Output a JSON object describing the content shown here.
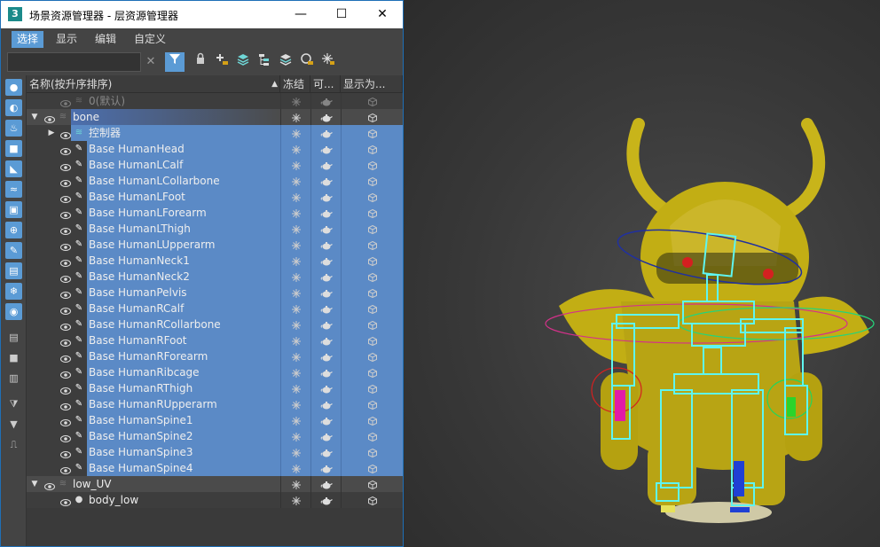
{
  "window": {
    "title": "场景资源管理器 - 层资源管理器",
    "app_icon_label": "3",
    "minimize_glyph": "—",
    "maximize_glyph": "☐",
    "close_glyph": "✕"
  },
  "menu": [
    "选择",
    "显示",
    "编辑",
    "自定义"
  ],
  "toolbar": {
    "search_value": "",
    "clear_glyph": "✕"
  },
  "columns": {
    "name": "名称(按升序排序)",
    "sort_glyph": "▲",
    "freeze": "冻结",
    "render": "可...",
    "display": "显示为..."
  },
  "rows": [
    {
      "label": "0(默认)",
      "level": 1,
      "type": "layer-default"
    },
    {
      "label": "bone",
      "level": 0,
      "type": "layer"
    },
    {
      "label": "控制器",
      "level": 1,
      "type": "group"
    },
    {
      "label": "Base HumanHead",
      "level": 2,
      "type": "bone"
    },
    {
      "label": "Base HumanLCalf",
      "level": 2,
      "type": "bone"
    },
    {
      "label": "Base HumanLCollarbone",
      "level": 2,
      "type": "bone"
    },
    {
      "label": "Base HumanLFoot",
      "level": 2,
      "type": "bone"
    },
    {
      "label": "Base HumanLForearm",
      "level": 2,
      "type": "bone"
    },
    {
      "label": "Base HumanLThigh",
      "level": 2,
      "type": "bone"
    },
    {
      "label": "Base HumanLUpperarm",
      "level": 2,
      "type": "bone"
    },
    {
      "label": "Base HumanNeck1",
      "level": 2,
      "type": "bone"
    },
    {
      "label": "Base HumanNeck2",
      "level": 2,
      "type": "bone"
    },
    {
      "label": "Base HumanPelvis",
      "level": 2,
      "type": "bone"
    },
    {
      "label": "Base HumanRCalf",
      "level": 2,
      "type": "bone"
    },
    {
      "label": "Base HumanRCollarbone",
      "level": 2,
      "type": "bone"
    },
    {
      "label": "Base HumanRFoot",
      "level": 2,
      "type": "bone"
    },
    {
      "label": "Base HumanRForearm",
      "level": 2,
      "type": "bone"
    },
    {
      "label": "Base HumanRibcage",
      "level": 2,
      "type": "bone"
    },
    {
      "label": "Base HumanRThigh",
      "level": 2,
      "type": "bone"
    },
    {
      "label": "Base HumanRUpperarm",
      "level": 2,
      "type": "bone"
    },
    {
      "label": "Base HumanSpine1",
      "level": 2,
      "type": "bone"
    },
    {
      "label": "Base HumanSpine2",
      "level": 2,
      "type": "bone"
    },
    {
      "label": "Base HumanSpine3",
      "level": 2,
      "type": "bone"
    },
    {
      "label": "Base HumanSpine4",
      "level": 2,
      "type": "bone"
    },
    {
      "label": "low_UV",
      "level": 0,
      "type": "layer"
    },
    {
      "label": "body_low",
      "level": 1,
      "type": "mesh"
    }
  ],
  "colors": {
    "selection": "#5b8ac6",
    "accent": "#5b9bd5",
    "panel": "#444444",
    "model": "#c8b41a",
    "bone_outline": "#5ff5f0"
  },
  "icons": {
    "eye": "eye-icon",
    "freeze": "snowflake-icon",
    "render": "teapot-icon",
    "display": "box-icon"
  }
}
